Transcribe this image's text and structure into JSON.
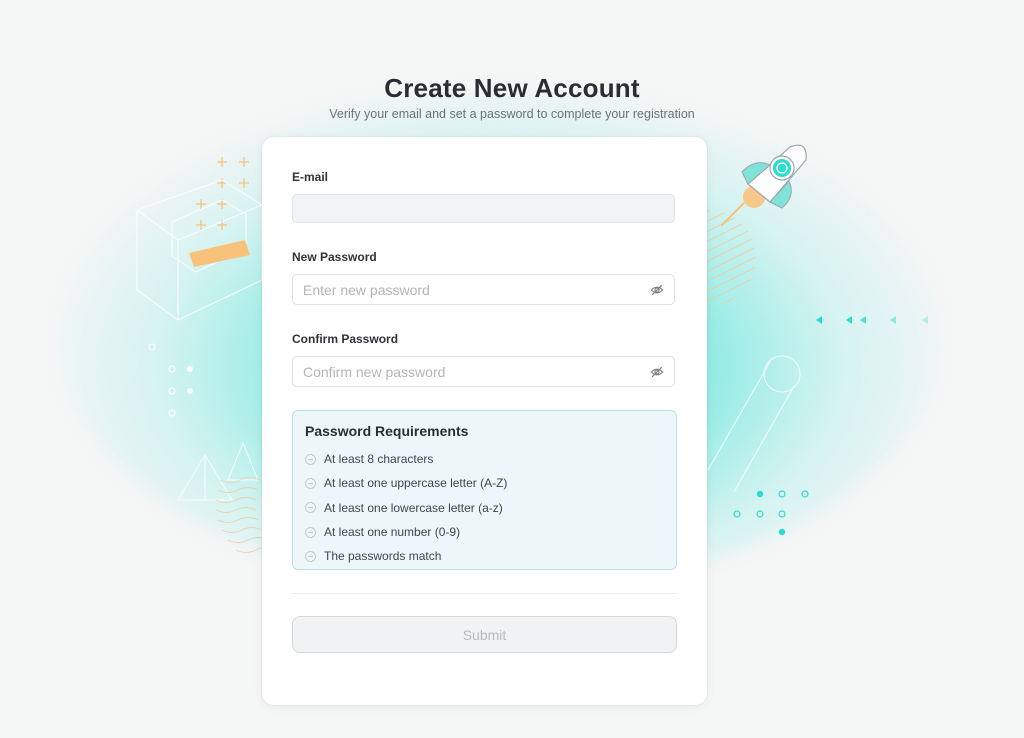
{
  "page": {
    "title": "Create New Account",
    "subtitle": "Verify your email and set a password to complete your registration"
  },
  "form": {
    "email": {
      "label": "E-mail",
      "value": "",
      "placeholder": ""
    },
    "new_password": {
      "label": "New Password",
      "value": "",
      "placeholder": "Enter new password",
      "toggle_icon": "eye-slash-icon"
    },
    "confirm_password": {
      "label": "Confirm Password",
      "value": "",
      "placeholder": "Confirm new password",
      "toggle_icon": "eye-slash-icon"
    },
    "requirements": {
      "title": "Password Requirements",
      "items": [
        {
          "text": "At least 8 characters",
          "icon": "minus-circle-icon"
        },
        {
          "text": "At least one uppercase letter (A-Z)",
          "icon": "minus-circle-icon"
        },
        {
          "text": "At least one lowercase letter (a-z)",
          "icon": "minus-circle-icon"
        },
        {
          "text": "At least one number (0-9)",
          "icon": "minus-circle-icon"
        },
        {
          "text": "The passwords match",
          "icon": "minus-circle-icon"
        }
      ]
    },
    "submit_label": "Submit"
  },
  "colors": {
    "accent": "#2ddccd",
    "background": "#f5f6f6",
    "card": "#ffffff",
    "requirements_bg": "#edf7fa",
    "requirements_border": "#b9e0ec",
    "decor_orange": "#f7c27a"
  }
}
